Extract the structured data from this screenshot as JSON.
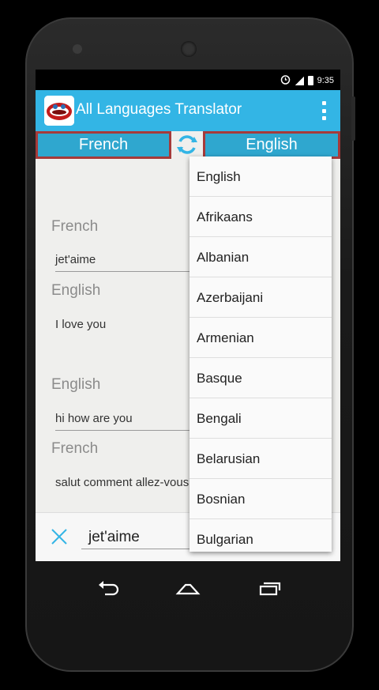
{
  "status": {
    "time": "9:35"
  },
  "app": {
    "title": "All Languages Translator"
  },
  "language_bar": {
    "source": "French",
    "target": "English"
  },
  "history": [
    {
      "from_label": "French",
      "from_text": "jet'aime",
      "to_label": "English",
      "to_text": "I love you"
    },
    {
      "from_label": "English",
      "from_text": "hi how are you",
      "to_label": "French",
      "to_text": "salut comment allez-vous"
    }
  ],
  "input": {
    "value": "jet'aime"
  },
  "dropdown": {
    "options": [
      "English",
      "Afrikaans",
      "Albanian",
      "Azerbaijani",
      "Armenian",
      "Basque",
      "Bengali",
      "Belarusian",
      "Bosnian",
      "Bulgarian"
    ]
  },
  "colors": {
    "accent": "#33b5e5",
    "lang_button": "#2fa7cf",
    "lang_border": "#a63a3a",
    "clear_icon": "#33b5e5"
  },
  "icons": [
    "alarm-icon",
    "signal-icon",
    "battery-icon",
    "overflow-menu-icon",
    "swap-icon",
    "clear-icon",
    "back-icon",
    "home-icon",
    "recents-icon"
  ]
}
